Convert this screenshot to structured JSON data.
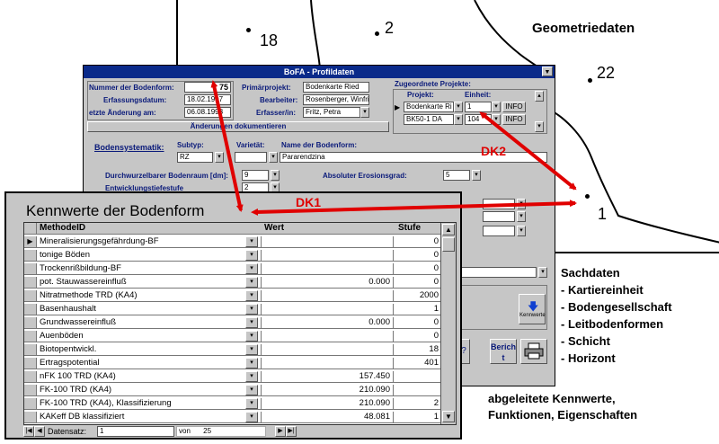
{
  "map": {
    "title": "Geometriedaten",
    "labels": [
      "18",
      "2",
      "22",
      "1"
    ]
  },
  "profile": {
    "title": "BoFA - Profildaten",
    "nummer_label": "Nummer der Bodenform:",
    "nummer_value": "75",
    "erfassungsdatum_label": "Erfassungsdatum:",
    "erfassungsdatum_value": "18.02.1997",
    "letzte_aenderung_label": "etzte Änderung am:",
    "letzte_aenderung_value": "06.08.1998",
    "primaerprojekt_label": "Primärprojekt:",
    "primaerprojekt_value": "Bodenkarte Ried",
    "bearbeiter_label": "Bearbeiter:",
    "bearbeiter_value": "Rosenberger, Winfrie",
    "erfasser_label": "Erfasser/in:",
    "erfasser_value": "Fritz, Petra",
    "aenderungen_button": "Änderungen dokumentieren",
    "zugeordnete_label": "Zugeordnete Projekte:",
    "projekt_col": "Projekt:",
    "einheit_col": "Einheit:",
    "projects": [
      {
        "projekt": "Bodenkarte Ri",
        "einheit": "1",
        "info": "INFO"
      },
      {
        "projekt": "BK50-1 DA",
        "einheit": "104",
        "info": "INFO"
      }
    ],
    "bodensystematik_label": "Bodensystematik:",
    "subtyp_label": "Subtyp:",
    "subtyp_value": "RZ",
    "varietaet_label": "Varietät:",
    "bodenform_name_label": "Name der Bodenform:",
    "bodenform_name_value": "Pararendzina",
    "durchwurzelbar_label": "Durchwurzelbarer Bodenraum [dm]:",
    "durchwurzelbar_value": "9",
    "erosionsgrad_label": "Absoluter Erosionsgrad:",
    "erosionsgrad_value": "5",
    "entwicklungstiefe_label": "Entwicklungstiefestufe",
    "entwicklungstiefe_value": "2",
    "kennwerte_btn": "Kennwerte",
    "bericht_btn": "Bericht"
  },
  "kennwerte": {
    "title": "Kennwerte der Bodenform",
    "columns": [
      "MethodeID",
      "Wert",
      "Stufe"
    ],
    "rows": [
      {
        "methode": "Mineralisierungsgefährdung-BF",
        "wert": "",
        "stufe": "0"
      },
      {
        "methode": "tonige Böden",
        "wert": "",
        "stufe": "0"
      },
      {
        "methode": "Trockenrißbildung-BF",
        "wert": "",
        "stufe": "0"
      },
      {
        "methode": "pot. Stauwassereinfluß",
        "wert": "0.000",
        "stufe": "0"
      },
      {
        "methode": "Nitratmethode TRD (KA4)",
        "wert": "",
        "stufe": "2000"
      },
      {
        "methode": "Basenhaushalt",
        "wert": "",
        "stufe": "1"
      },
      {
        "methode": "Grundwassereinfluß",
        "wert": "0.000",
        "stufe": "0"
      },
      {
        "methode": "Auenböden",
        "wert": "",
        "stufe": "0"
      },
      {
        "methode": "Biotopentwickl.",
        "wert": "",
        "stufe": "18"
      },
      {
        "methode": "Ertragspotential",
        "wert": "",
        "stufe": "401"
      },
      {
        "methode": "nFK 100 TRD (KA4)",
        "wert": "157.450",
        "stufe": ""
      },
      {
        "methode": "FK-100 TRD (KA4)",
        "wert": "210.090",
        "stufe": ""
      },
      {
        "methode": "FK-100 TRD (KA4), Klassifizierung",
        "wert": "210.090",
        "stufe": "2"
      },
      {
        "methode": "KAKeff DB klassifiziert",
        "wert": "48.081",
        "stufe": "1"
      }
    ],
    "nav_label": "Datensatz:",
    "nav_record": "1",
    "nav_of": "von",
    "nav_total": "25"
  },
  "annotations": {
    "dk1": "DK1",
    "dk2": "DK2",
    "sachdaten_title": "Sachdaten",
    "sachdaten_items": [
      "- Kartiereinheit",
      "- Bodengesellschaft",
      "- Leitbodenformen",
      "- Schicht",
      "- Horizont"
    ],
    "abgeleitet_line1": "abgeleitete Kennwerte,",
    "abgeleitet_line2": "Funktionen, Eigenschaften"
  },
  "colors": {
    "arrow": "#e00000",
    "titlebar": "#0a2a8a",
    "window_bg": "#c6c6c6"
  }
}
